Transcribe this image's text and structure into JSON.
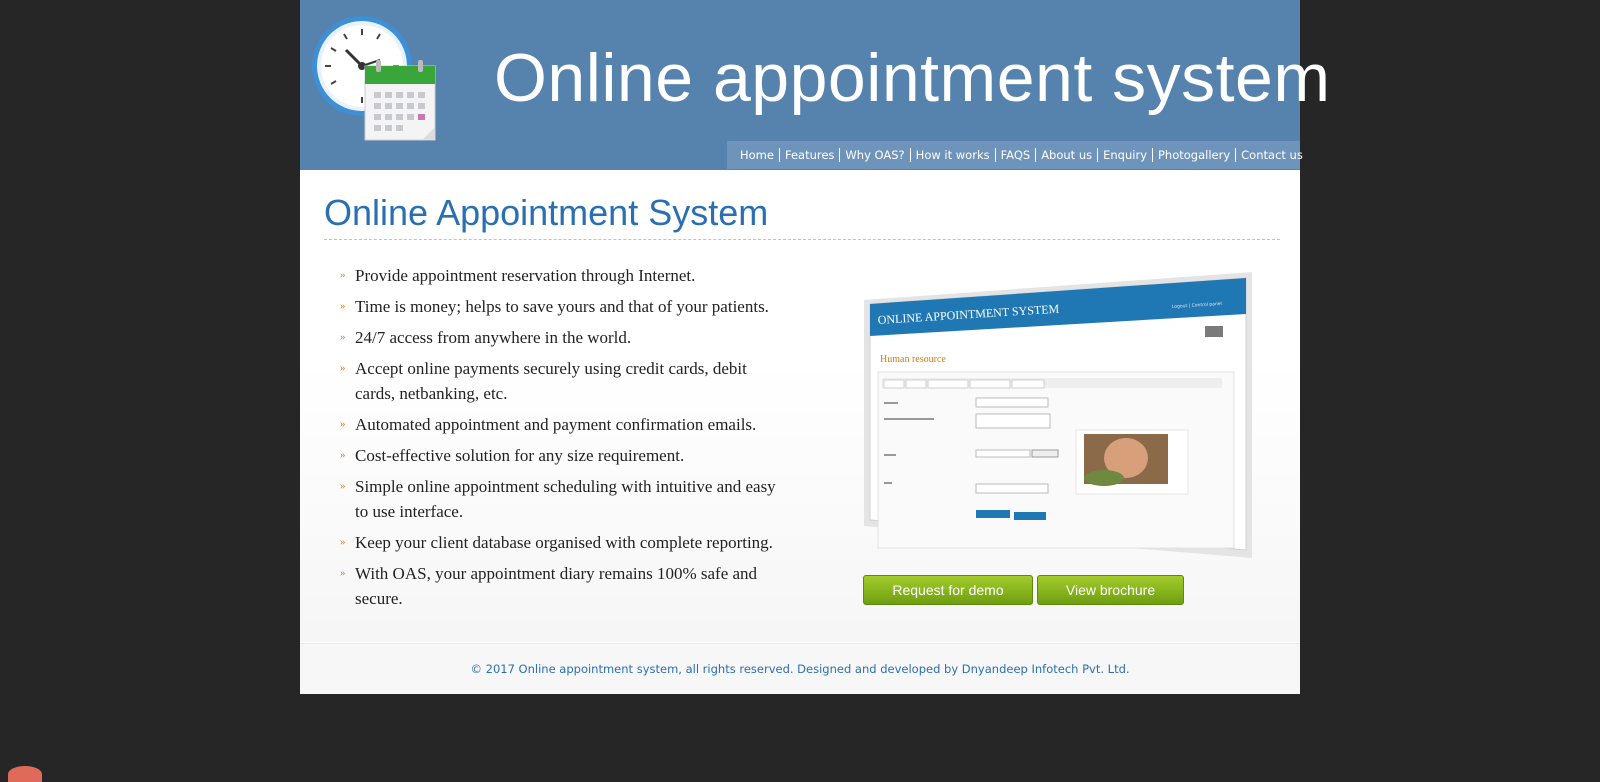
{
  "header": {
    "title": "Online appointment system",
    "logo_icon": "clock-calendar-icon"
  },
  "nav": {
    "items": [
      {
        "label": "Home"
      },
      {
        "label": "Features"
      },
      {
        "label": "Why OAS?"
      },
      {
        "label": "How it works"
      },
      {
        "label": "FAQS"
      },
      {
        "label": "About us"
      },
      {
        "label": "Enquiry"
      },
      {
        "label": "Photogallery"
      },
      {
        "label": "Contact us"
      }
    ]
  },
  "main": {
    "title": "Online Appointment System",
    "features": [
      "Provide appointment reservation through Internet.",
      "Time is money; helps to save yours and that of your patients.",
      "24/7 access from anywhere in the world.",
      "Accept online payments securely using credit cards, debit cards, netbanking, etc.",
      "Automated appointment and payment confirmation emails.",
      "Cost-effective solution for any size requirement.",
      "Simple online appointment scheduling with intuitive and easy to use interface.",
      "Keep your client database organised with complete reporting.",
      "With OAS, your appointment diary remains 100% safe and secure."
    ],
    "screenshot": {
      "app_title": "ONLINE APPOINTMENT SYSTEM",
      "top_links": "Logout  |  Control panel",
      "section_title": "Human resource"
    },
    "buttons": {
      "demo": "Request for demo",
      "brochure": "View brochure"
    }
  },
  "footer": {
    "copyright": "© 2017 Online appointment system, all rights reserved. Designed and developed by Dnyandeep Infotech Pvt. Ltd."
  },
  "colors": {
    "header_bg": "#5682ae",
    "nav_bg": "#6f94bb",
    "title_blue": "#2a6fb2",
    "button_green": "#8ab81e",
    "bullet_orange": "#e07a10"
  }
}
